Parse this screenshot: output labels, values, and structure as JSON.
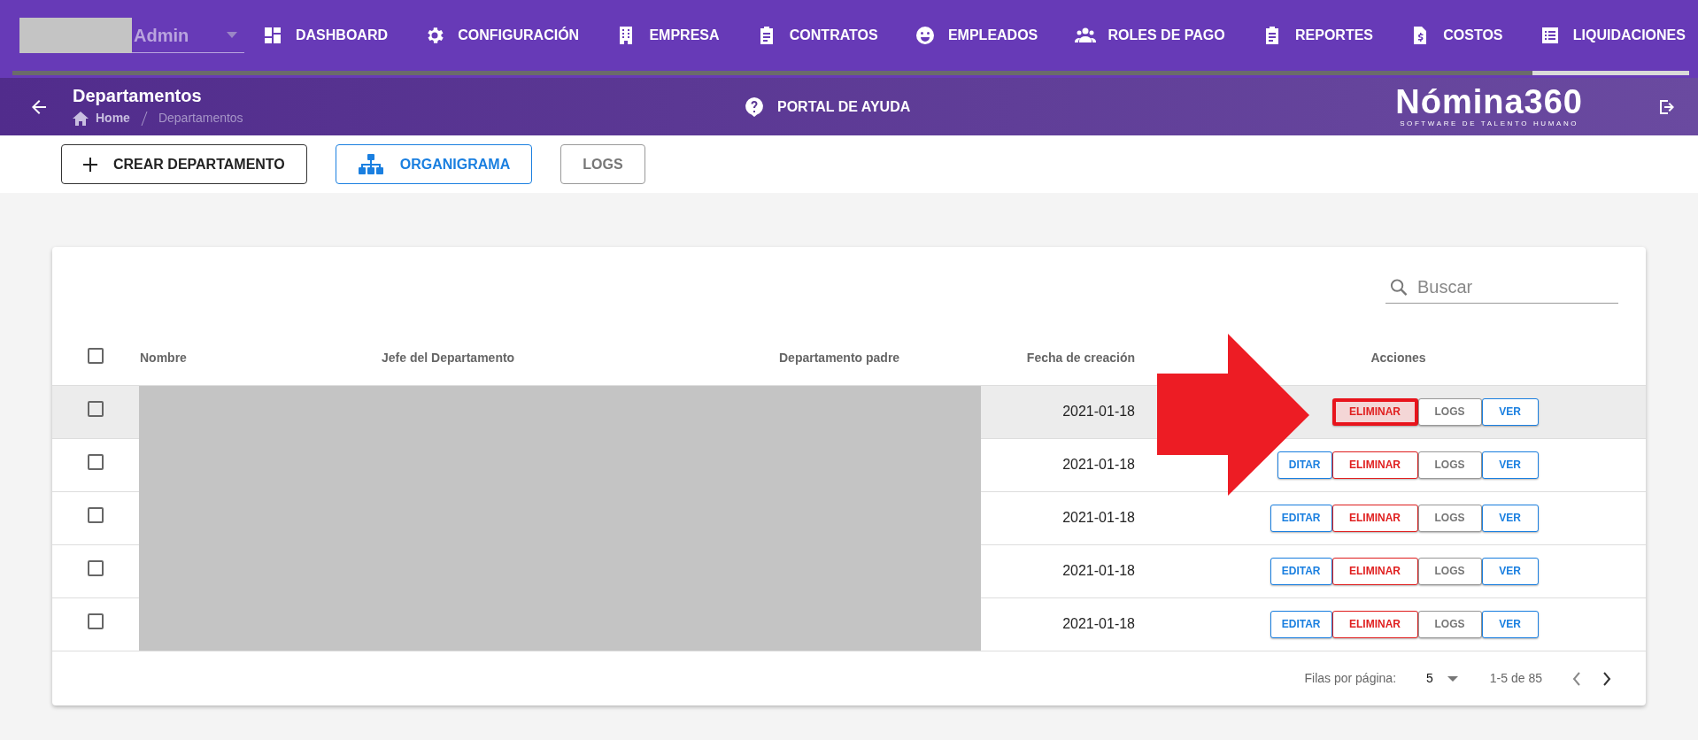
{
  "nav": {
    "user": {
      "name": "Admin"
    },
    "items": [
      {
        "label": "DASHBOARD",
        "selected": false
      },
      {
        "label": "CONFIGURACIÓN",
        "selected": false
      },
      {
        "label": "EMPRESA",
        "selected": false
      },
      {
        "label": "CONTRATOS",
        "selected": false
      },
      {
        "label": "EMPLEADOS",
        "selected": false
      },
      {
        "label": "ROLES DE PAGO",
        "selected": false
      },
      {
        "label": "REPORTES",
        "selected": false
      },
      {
        "label": "COSTOS",
        "selected": false
      },
      {
        "label": "LIQUIDACIONES",
        "selected": true
      }
    ]
  },
  "header": {
    "title": "Departamentos",
    "breadcrumb": [
      "Home",
      "Departamentos"
    ],
    "help": "PORTAL DE AYUDA",
    "logo": {
      "name": "Nómina360",
      "tagline": "SOFTWARE DE TALENTO HUMANO"
    }
  },
  "toolbar": [
    {
      "label": "CREAR DEPARTAMENTO",
      "kind": "create"
    },
    {
      "label": "ORGANIGRAMA",
      "kind": "chart"
    },
    {
      "label": "LOGS",
      "kind": "plain"
    }
  ],
  "table": {
    "search": {
      "placeholder": "Buscar"
    },
    "select_all": {
      "checked": false
    },
    "columns": [
      "Nombre",
      "Jefe del Departamento",
      "Departamento padre",
      "Fecha de creación",
      "Acciones"
    ],
    "rows": [
      {
        "checked": false,
        "hovered": true,
        "date": "2021-01-18",
        "actions": [
          {
            "kind": "delete",
            "label": "ELIMINAR",
            "highlighted": true
          },
          {
            "kind": "logs",
            "label": "LOGS",
            "highlighted": false
          },
          {
            "kind": "view",
            "label": "VER",
            "highlighted": false
          }
        ]
      },
      {
        "checked": false,
        "hovered": false,
        "date": "2021-01-18",
        "actions": [
          {
            "kind": "edit",
            "label": "DITAR",
            "highlighted": false
          },
          {
            "kind": "delete",
            "label": "ELIMINAR",
            "highlighted": false
          },
          {
            "kind": "logs",
            "label": "LOGS",
            "highlighted": false
          },
          {
            "kind": "view",
            "label": "VER",
            "highlighted": false
          }
        ]
      },
      {
        "checked": false,
        "hovered": false,
        "date": "2021-01-18",
        "actions": [
          {
            "kind": "edit",
            "label": "EDITAR",
            "highlighted": false
          },
          {
            "kind": "delete",
            "label": "ELIMINAR",
            "highlighted": false
          },
          {
            "kind": "logs",
            "label": "LOGS",
            "highlighted": false
          },
          {
            "kind": "view",
            "label": "VER",
            "highlighted": false
          }
        ]
      },
      {
        "checked": false,
        "hovered": false,
        "date": "2021-01-18",
        "actions": [
          {
            "kind": "edit",
            "label": "EDITAR",
            "highlighted": false
          },
          {
            "kind": "delete",
            "label": "ELIMINAR",
            "highlighted": false
          },
          {
            "kind": "logs",
            "label": "LOGS",
            "highlighted": false
          },
          {
            "kind": "view",
            "label": "VER",
            "highlighted": false
          }
        ]
      },
      {
        "checked": false,
        "hovered": false,
        "date": "2021-01-18",
        "actions": [
          {
            "kind": "edit",
            "label": "EDITAR",
            "highlighted": false
          },
          {
            "kind": "delete",
            "label": "ELIMINAR",
            "highlighted": false
          },
          {
            "kind": "logs",
            "label": "LOGS",
            "highlighted": false
          },
          {
            "kind": "view",
            "label": "VER",
            "highlighted": false
          }
        ]
      }
    ],
    "footer": {
      "rows_per_page_label": "Filas por página:",
      "rows_per_page": "5",
      "range": "1-5 de 85"
    }
  },
  "annotation": {
    "kind": "arrow"
  }
}
